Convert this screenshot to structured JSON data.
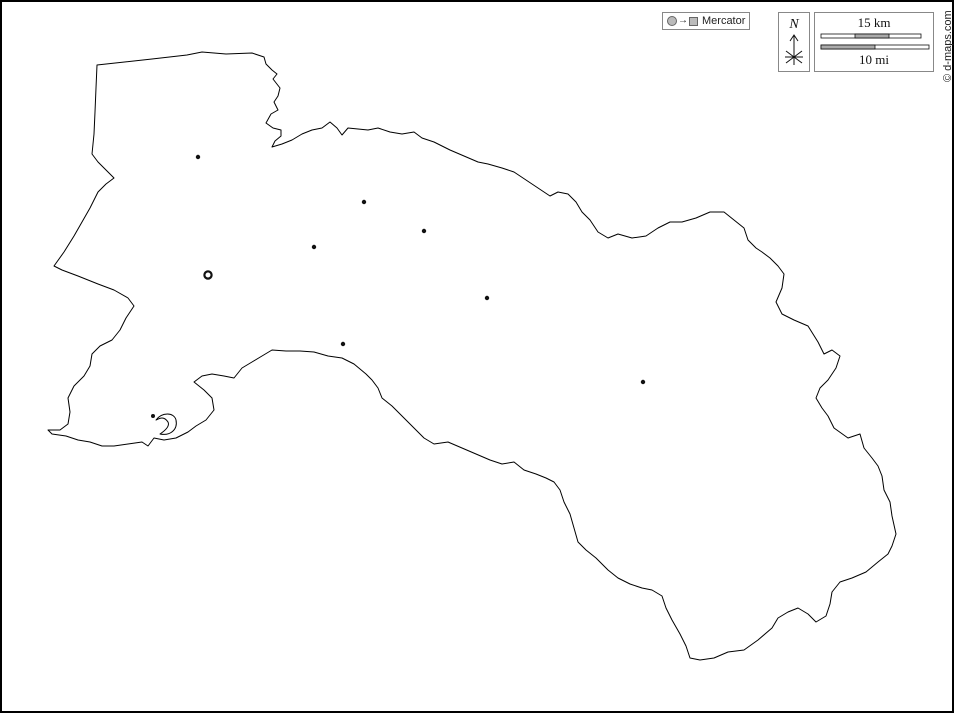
{
  "map": {
    "projection_label": "Mercator",
    "north_label": "N",
    "scale_km_label": "15 km",
    "scale_mi_label": "10 mi",
    "credit": "© d-maps.com"
  },
  "colors": {
    "background": "#ffffff",
    "outline": "#000000",
    "marker": "#111111"
  },
  "icons": [
    "north-arrow-icon",
    "circle-to-square-projection-icon"
  ]
}
